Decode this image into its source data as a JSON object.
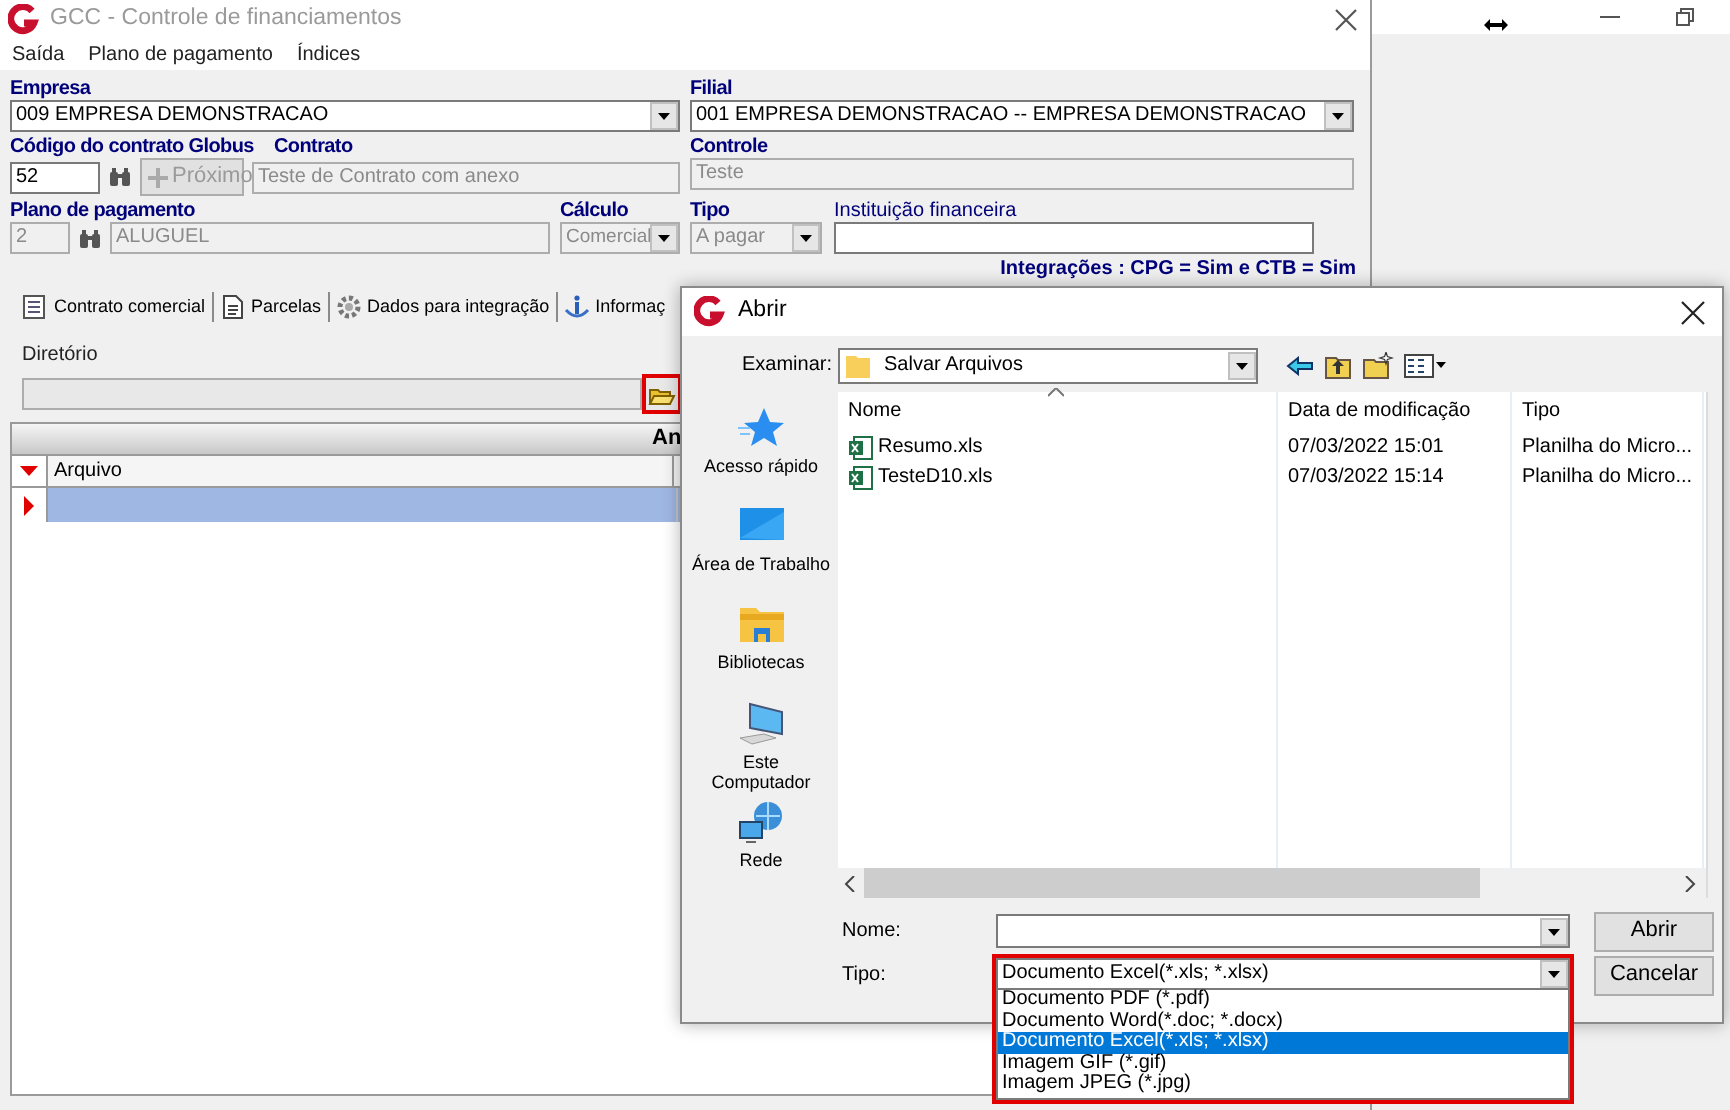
{
  "main_window": {
    "title": "GCC - Controle de financiamentos",
    "menu": [
      "Saída",
      "Plano de pagamento",
      "Índices"
    ],
    "empresa": {
      "label": "Empresa",
      "value": "009 EMPRESA DEMONSTRACAO",
      "disabled": false
    },
    "filial": {
      "label": "Filial",
      "value": "001 EMPRESA DEMONSTRACAO -- EMPRESA DEMONSTRACAO",
      "disabled": false
    },
    "codigo": {
      "label": "Código do contrato Globus",
      "value": "52",
      "disabled": false
    },
    "next_button": {
      "label": "Próximo",
      "disabled": true
    },
    "contrato": {
      "label": "Contrato",
      "value": "Teste de Contrato com anexo",
      "disabled": true
    },
    "controle": {
      "label": "Controle",
      "value": "Teste",
      "disabled": true
    },
    "plano": {
      "label": "Plano de pagamento",
      "code": "2",
      "name": "ALUGUEL",
      "disabled": true
    },
    "calculo": {
      "label": "Cálculo",
      "value": "Comercial",
      "disabled": true
    },
    "tipo": {
      "label": "Tipo",
      "value": "A pagar",
      "disabled": true
    },
    "instituicao": {
      "label": "Instituição financeira",
      "disabled": false
    },
    "integracoes": "Integrações : CPG = Sim e CTB = Sim",
    "tabs": [
      {
        "label": "Contrato comercial",
        "kind": "form",
        "selected": false
      },
      {
        "label": "Parcelas",
        "kind": "document",
        "selected": false
      },
      {
        "label": "Dados para integração",
        "kind": "gear",
        "selected": false
      },
      {
        "label": "Informaç",
        "kind": "info",
        "selected": false
      }
    ],
    "directory": {
      "label": "Diretório",
      "disabled": true,
      "browse_highlighted": true
    },
    "grid": {
      "title": "An",
      "columns": [
        "Arquivo"
      ],
      "rows": [
        {
          "selected": true
        }
      ]
    }
  },
  "dialog": {
    "title": "Abrir",
    "look_in": {
      "label": "Examinar:",
      "value": "Salvar Arquivos"
    },
    "places": [
      {
        "label": "Acesso rápido",
        "kind": "star"
      },
      {
        "label": "Área de Trabalho",
        "kind": "desktop"
      },
      {
        "label": "Bibliotecas",
        "kind": "library"
      },
      {
        "label": "Este Computador",
        "kind": "computer"
      },
      {
        "label": "Rede",
        "kind": "network"
      }
    ],
    "columns": [
      "Nome",
      "Data de modificação",
      "Tipo"
    ],
    "files": [
      {
        "name": "Resumo.xls",
        "modified": "07/03/2022 15:01",
        "type": "Planilha do Micro..."
      },
      {
        "name": "TesteD10.xls",
        "modified": "07/03/2022 15:14",
        "type": "Planilha do Micro..."
      }
    ],
    "file_name": {
      "label": "Nome:"
    },
    "file_type": {
      "label": "Tipo:",
      "value": "Documento Excel(*.xls; *.xlsx)",
      "highlighted": true,
      "expanded": true
    },
    "file_types": [
      {
        "label": "Documento PDF (*.pdf)",
        "selected": false
      },
      {
        "label": "Documento Word(*.doc; *.docx)",
        "selected": false
      },
      {
        "label": "Documento Excel(*.xls; *.xlsx)",
        "selected": true
      },
      {
        "label": "Imagem GIF (*.gif)",
        "selected": false
      },
      {
        "label": "Imagem JPEG (*.jpg)",
        "selected": false
      }
    ],
    "buttons": [
      "Abrir",
      "Cancelar"
    ]
  }
}
